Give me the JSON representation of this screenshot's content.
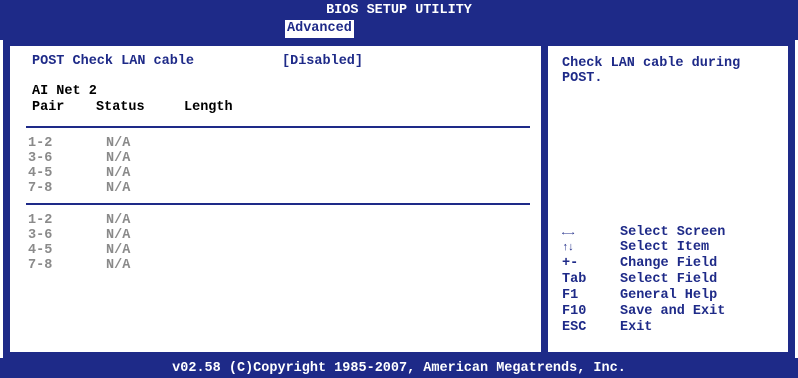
{
  "header": {
    "title": "BIOS SETUP UTILITY",
    "active_tab": "Advanced"
  },
  "main": {
    "setting": {
      "label": "POST Check LAN cable",
      "value": "[Disabled]"
    },
    "section_title": "AI Net 2",
    "columns": [
      "Pair",
      "Status",
      "Length"
    ],
    "group1": [
      {
        "pair": "1-2",
        "status": "N/A"
      },
      {
        "pair": "3-6",
        "status": "N/A"
      },
      {
        "pair": "4-5",
        "status": "N/A"
      },
      {
        "pair": "7-8",
        "status": "N/A"
      }
    ],
    "group2": [
      {
        "pair": "1-2",
        "status": "N/A"
      },
      {
        "pair": "3-6",
        "status": "N/A"
      },
      {
        "pair": "4-5",
        "status": "N/A"
      },
      {
        "pair": "7-8",
        "status": "N/A"
      }
    ]
  },
  "help": {
    "lines": [
      "Check LAN cable during",
      "POST."
    ],
    "keys": [
      {
        "key": "←→",
        "desc": "Select Screen",
        "icon": "left-right-arrows-icon"
      },
      {
        "key": "↑↓",
        "desc": "Select Item",
        "icon": "up-down-arrows-icon"
      },
      {
        "key": "+-",
        "desc": "Change Field"
      },
      {
        "key": "Tab",
        "desc": "Select Field"
      },
      {
        "key": "F1",
        "desc": "General Help"
      },
      {
        "key": "F10",
        "desc": "Save and Exit"
      },
      {
        "key": "ESC",
        "desc": "Exit"
      }
    ]
  },
  "footer": {
    "copyright": "v02.58 (C)Copyright 1985-2007, American Megatrends, Inc."
  },
  "colors": {
    "frame_blue": "#1e2a88",
    "disabled_gray": "#8a8a8a"
  }
}
